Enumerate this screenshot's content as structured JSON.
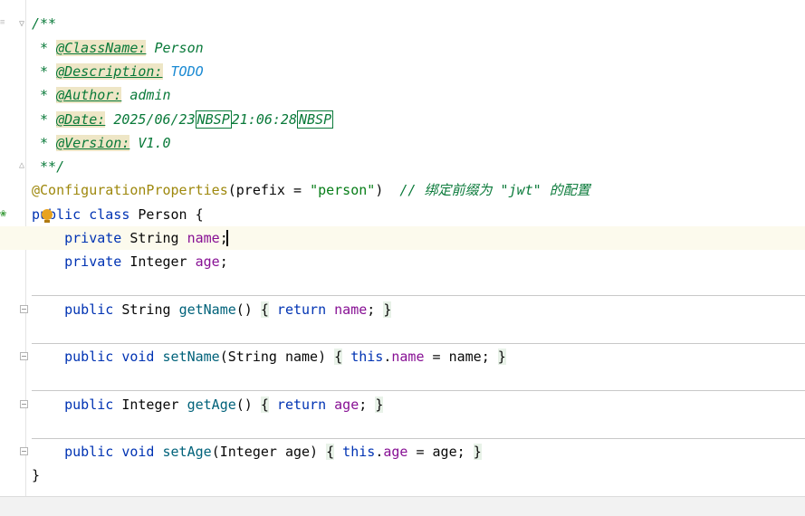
{
  "code": {
    "doc_open": "/**",
    "doc_classname_tag": "@ClassName:",
    "doc_classname_val": "Person",
    "doc_desc_tag": "@Description:",
    "doc_desc_val": "TODO",
    "doc_author_tag": "@Author:",
    "doc_author_val": "admin",
    "doc_date_tag": "@Date:",
    "doc_date_part1": "2025/06/23",
    "doc_nbsp1": "NBSP",
    "doc_date_part2": "21:06:28",
    "doc_nbsp2": "NBSP",
    "doc_version_tag": "@Version:",
    "doc_version_val": "V1.0",
    "doc_close": " **/",
    "annotation": "@ConfigurationProperties",
    "anno_args_pre": "(prefix = ",
    "anno_string": "\"person\"",
    "anno_args_post": ")  ",
    "anno_comment": "// 绑定前缀为 \"jwt\" 的配置",
    "class_kw": "public class",
    "class_name": " Person {",
    "field1_kw": "private",
    "field1_type": " String ",
    "field1_name": "name",
    "field1_end": ";",
    "field2_kw": "private",
    "field2_type": " Integer ",
    "field2_name": "age",
    "field2_end": ";",
    "m1_kw": "public",
    "m1_type": " String ",
    "m1_name": "getName",
    "m1_parens": "() ",
    "m1_open": "{",
    "m1_ret": " return ",
    "m1_field": "name",
    "m1_semi": "; ",
    "m1_close": "}",
    "m2_kw": "public void",
    "m2_name": " setName",
    "m2_parens": "(String name) ",
    "m2_open": "{",
    "m2_this": " this",
    "m2_dot": ".",
    "m2_field": "name",
    "m2_assign": " = name; ",
    "m2_close": "}",
    "m3_kw": "public",
    "m3_type": " Integer ",
    "m3_name": "getAge",
    "m3_parens": "() ",
    "m3_open": "{",
    "m3_ret": " return ",
    "m3_field": "age",
    "m3_semi": "; ",
    "m3_close": "}",
    "m4_kw": "public void",
    "m4_name": " setAge",
    "m4_parens": "(Integer age) ",
    "m4_open": "{",
    "m4_this": " this",
    "m4_dot": ".",
    "m4_field": "age",
    "m4_assign": " = age; ",
    "m4_close": "}",
    "class_close": "}"
  },
  "icons": {
    "gutter_bean": "spring-bean-icon",
    "intention": "lightbulb-icon"
  },
  "colors": {
    "keyword": "#0033b3",
    "doc_comment": "#0a7a3a",
    "field": "#871094",
    "method": "#00627a",
    "annotation": "#9e880d",
    "string": "#067d17"
  }
}
